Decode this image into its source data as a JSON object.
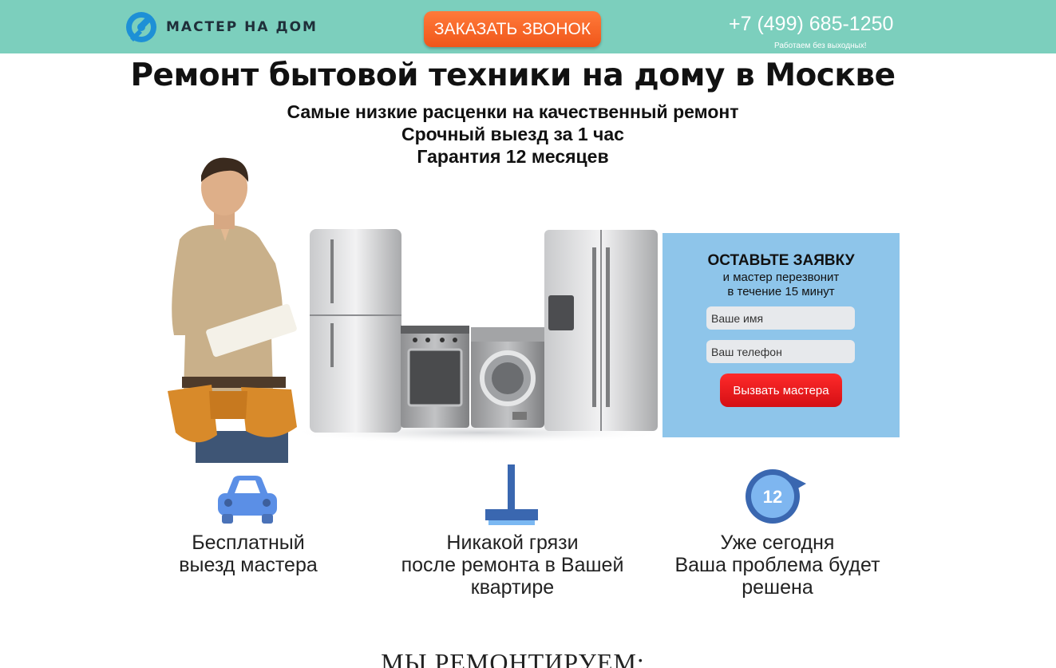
{
  "header": {
    "logo_text": "МАСТЕР НА ДОМ",
    "call_button": "ЗАКАЗАТЬ ЗВОНОК",
    "phone": "+7 (499) 685-1250",
    "work_note": "Работаем без выходных!"
  },
  "hero": {
    "title": "Ремонт бытовой техники на дому в Москве",
    "subtitles": [
      "Самые низкие расценки на качественный ремонт",
      "Срочный выезд за 1 час",
      "Гарантия 12 месяцев"
    ]
  },
  "form": {
    "title": "ОСТАВЬТЕ ЗАЯВКУ",
    "line1": "и мастер перезвонит",
    "line2": "в течение 15 минут",
    "name_placeholder": "Ваше имя",
    "phone_placeholder": "Ваш телефон",
    "submit_label": "Вызвать мастера"
  },
  "features": [
    {
      "icon": "car-icon",
      "lines": [
        "Бесплатный",
        "выезд мастера"
      ]
    },
    {
      "icon": "mop-icon",
      "lines": [
        "Никакой грязи",
        "после ремонта в Вашей",
        "квартире"
      ]
    },
    {
      "icon": "clock-12-icon",
      "badge": "12",
      "lines": [
        "Уже сегодня",
        "Ваша проблема будет",
        "решена"
      ]
    }
  ],
  "section_title": "МЫ РЕМОНТИРУЕМ:",
  "colors": {
    "header_bg": "#7ccfbd",
    "call_button": "#f0561a",
    "form_bg": "#8ec5ea",
    "submit_button": "#d40f14",
    "icon_blue": "#5b8fe6"
  }
}
